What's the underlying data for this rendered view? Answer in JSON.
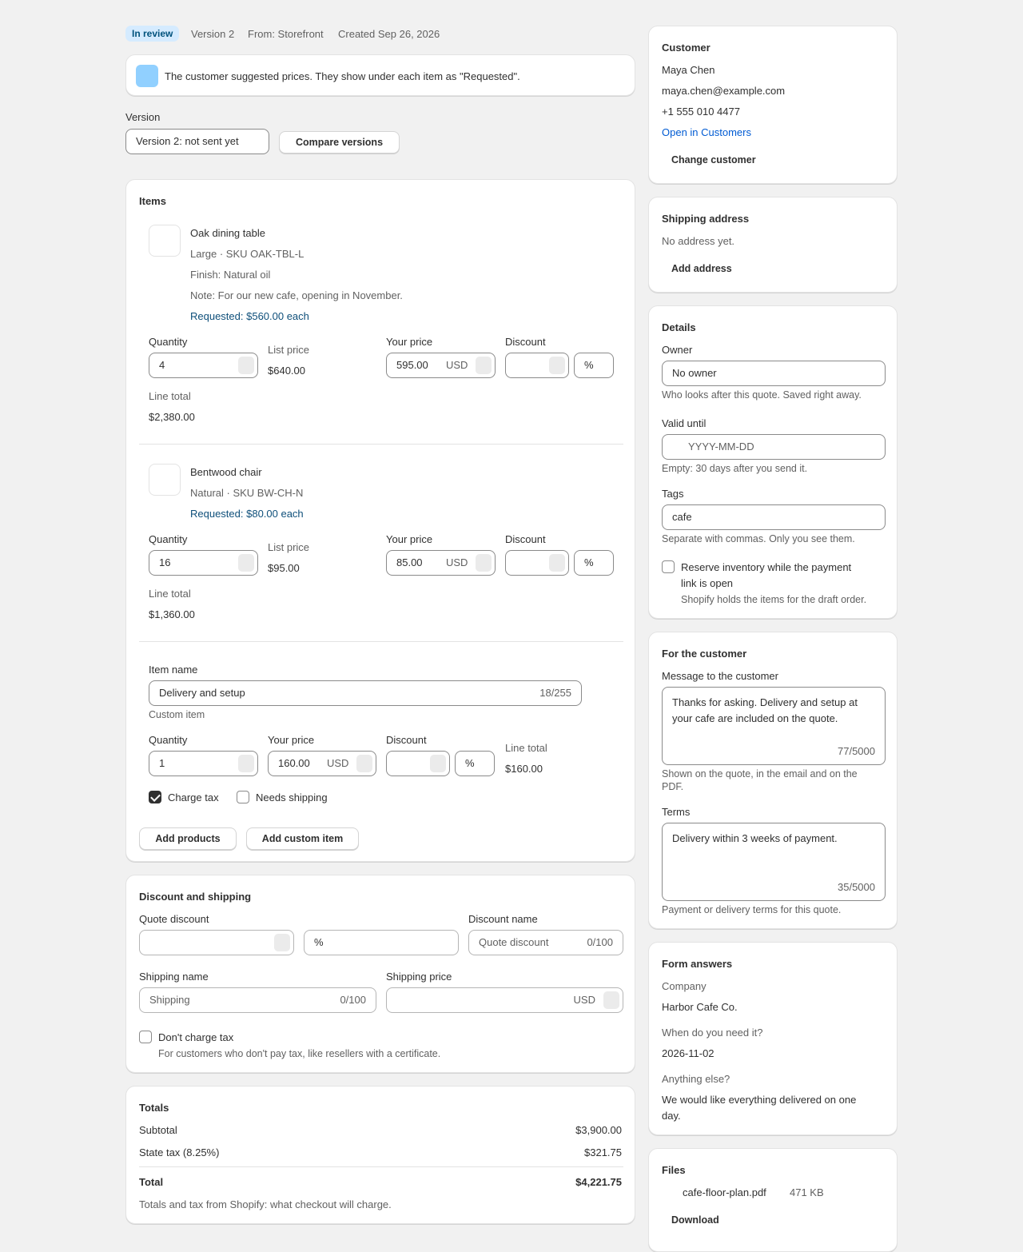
{
  "header": {
    "status_badge": "In review",
    "version": "Version 2",
    "source": "From: Storefront",
    "created": "Created Sep 26, 2026"
  },
  "banner": {
    "text": "The customer suggested prices. They show under each item as \"Requested\".",
    "icon": "info-icon"
  },
  "version_select": {
    "label": "Version",
    "value": "Version 2: not sent yet",
    "compare_button": "Compare versions"
  },
  "items": {
    "title": "Items",
    "products": [
      {
        "name": "Oak dining table",
        "variant": "Large · SKU OAK-TBL-L",
        "finish": "Finish: Natural oil",
        "note": "Note: For our new cafe, opening in November.",
        "requested": "Requested: $560.00 each",
        "quantity_label": "Quantity",
        "quantity": "4",
        "list_price_label": "List price",
        "list_price": "$640.00",
        "your_price_label": "Your price",
        "your_price": "595.00",
        "currency": "USD",
        "discount_label": "Discount",
        "discount_value": "",
        "discount_unit": "%",
        "line_total_label": "Line total",
        "line_total": "$2,380.00"
      },
      {
        "name": "Bentwood chair",
        "variant": "Natural · SKU BW-CH-N",
        "requested": "Requested: $80.00 each",
        "quantity_label": "Quantity",
        "quantity": "16",
        "list_price_label": "List price",
        "list_price": "$95.00",
        "your_price_label": "Your price",
        "your_price": "85.00",
        "currency": "USD",
        "discount_label": "Discount",
        "discount_value": "",
        "discount_unit": "%",
        "line_total_label": "Line total",
        "line_total": "$1,360.00"
      }
    ],
    "custom_item": {
      "name_label": "Item name",
      "name_value": "Delivery and setup",
      "name_counter": "18/255",
      "type": "Custom item",
      "quantity_label": "Quantity",
      "quantity": "1",
      "your_price_label": "Your price",
      "your_price": "160.00",
      "currency": "USD",
      "discount_label": "Discount",
      "discount_unit": "%",
      "line_total_label": "Line total",
      "line_total": "$160.00",
      "charge_tax_label": "Charge tax",
      "charge_tax_checked": true,
      "needs_shipping_label": "Needs shipping",
      "needs_shipping_checked": false
    },
    "add_products_button": "Add products",
    "add_custom_item_button": "Add custom item"
  },
  "discount_shipping": {
    "title": "Discount and shipping",
    "quote_discount_label": "Quote discount",
    "quote_discount_unit": "%",
    "discount_name_label": "Discount name",
    "discount_name_placeholder": "Quote discount",
    "discount_name_counter": "0/100",
    "shipping_name_label": "Shipping name",
    "shipping_name_placeholder": "Shipping",
    "shipping_name_counter": "0/100",
    "shipping_price_label": "Shipping price",
    "shipping_currency": "USD",
    "dont_charge_tax_label": "Don't charge tax",
    "dont_charge_tax_help": "For customers who don't pay tax, like resellers with a certificate."
  },
  "totals": {
    "title": "Totals",
    "subtotal_label": "Subtotal",
    "subtotal": "$3,900.00",
    "tax_label": "State tax (8.25%)",
    "tax": "$321.75",
    "total_label": "Total",
    "total": "$4,221.75",
    "note": "Totals and tax from Shopify: what checkout will charge."
  },
  "customer": {
    "title": "Customer",
    "name": "Maya Chen",
    "email": "maya.chen@example.com",
    "phone": "+1 555 010 4477",
    "open_link": "Open in Customers",
    "change_button": "Change customer"
  },
  "shipping_address": {
    "title": "Shipping address",
    "empty": "No address yet.",
    "add_button": "Add address"
  },
  "details": {
    "title": "Details",
    "owner_label": "Owner",
    "owner_value": "No owner",
    "owner_help": "Who looks after this quote. Saved right away.",
    "valid_label": "Valid until",
    "valid_placeholder": "YYYY-MM-DD",
    "valid_help": "Empty: 30 days after you send it.",
    "tags_label": "Tags",
    "tags_value": "cafe",
    "tags_help": "Separate with commas. Only you see them.",
    "reserve_label_1": "Reserve inventory while the payment",
    "reserve_label_2": "link is open",
    "reserve_help": "Shopify holds the items for the draft order."
  },
  "for_customer": {
    "title": "For the customer",
    "message_label": "Message to the customer",
    "message_line1": "Thanks for asking. Delivery and setup at",
    "message_line2": "your cafe are included on the quote.",
    "message_counter": "77/5000",
    "message_help_1": "Shown on the quote, in the email and on the",
    "message_help_2": "PDF.",
    "terms_label": "Terms",
    "terms_value": "Delivery within 3 weeks of payment.",
    "terms_counter": "35/5000",
    "terms_help": "Payment or delivery terms for this quote."
  },
  "form_answers": {
    "title": "Form answers",
    "q1": "Company",
    "a1": "Harbor Cafe Co.",
    "q2": "When do you need it?",
    "a2": "2026-11-02",
    "q3": "Anything else?",
    "a3_line1": "We would like everything delivered on one",
    "a3_line2": "day."
  },
  "files": {
    "title": "Files",
    "file_name": "cafe-floor-plan.pdf",
    "file_size": "471 KB",
    "download_button": "Download"
  },
  "colors": {
    "badge_bg": "#d5ebff",
    "badge_text": "#00527c",
    "banner_icon": "#91d0ff",
    "link": "#005bd3",
    "requested": "#0e4f7a"
  }
}
